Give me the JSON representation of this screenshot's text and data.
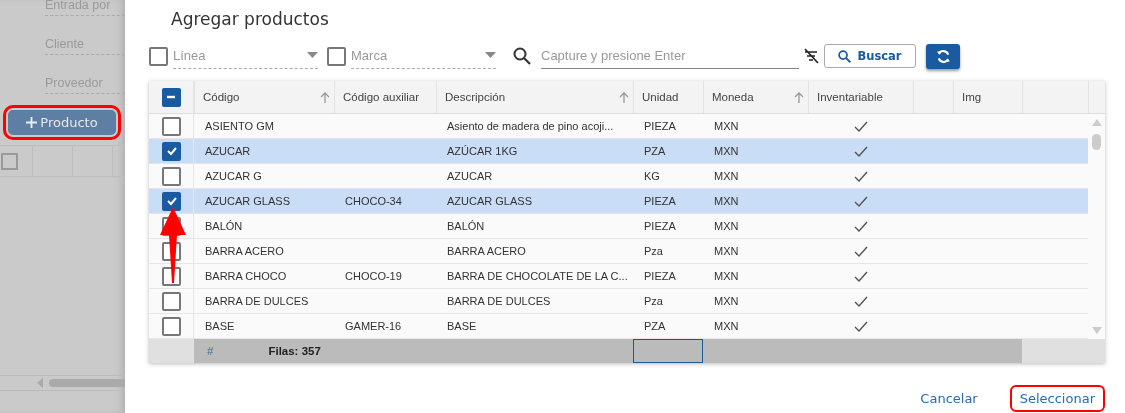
{
  "background_form": {
    "fields": [
      {
        "placeholder": "Entrada por"
      },
      {
        "placeholder": "Cliente"
      },
      {
        "placeholder": "Proveedor"
      }
    ],
    "add_button": {
      "label": "Producto",
      "highlighted": true
    },
    "grid": {
      "select_all_checked": false
    }
  },
  "dialog": {
    "title": "Agregar productos",
    "filters": [
      {
        "placeholder": "Línea",
        "checked": false
      },
      {
        "placeholder": "Marca",
        "checked": false
      }
    ],
    "search": {
      "placeholder": "Capture y presione Enter"
    },
    "search_button": {
      "label": "Buscar"
    },
    "table": {
      "select_all_partial": true,
      "columns": [
        {
          "label": "Código",
          "sortable": true
        },
        {
          "label": "Código auxiliar",
          "sortable": false
        },
        {
          "label": "Descripción",
          "sortable": true
        },
        {
          "label": "Unidad",
          "sortable": false
        },
        {
          "label": "Moneda",
          "sortable": true
        },
        {
          "label": "Inventariable",
          "sortable": false
        },
        {
          "label": "Img",
          "sortable": false
        }
      ],
      "rows": [
        {
          "selected": false,
          "codigo": "ASIENTO GM",
          "codigo_auxiliar": "",
          "descripcion": "Asiento de madera de pino acoji...",
          "unidad": "PIEZA",
          "moneda": "MXN",
          "inventariable": true
        },
        {
          "selected": true,
          "codigo": "AZUCAR",
          "codigo_auxiliar": "",
          "descripcion": "AZÚCAR 1KG",
          "unidad": "PZA",
          "moneda": "MXN",
          "inventariable": true
        },
        {
          "selected": false,
          "codigo": "AZUCAR G",
          "codigo_auxiliar": "",
          "descripcion": "AZUCAR",
          "unidad": "KG",
          "moneda": "MXN",
          "inventariable": true
        },
        {
          "selected": true,
          "codigo": "AZUCAR GLASS",
          "codigo_auxiliar": "CHOCO-34",
          "descripcion": "AZUCAR GLASS",
          "unidad": "PIEZA",
          "moneda": "MXN",
          "inventariable": true
        },
        {
          "selected": false,
          "codigo": "BALÓN",
          "codigo_auxiliar": "",
          "descripcion": "BALÓN",
          "unidad": "PIEZA",
          "moneda": "MXN",
          "inventariable": true
        },
        {
          "selected": false,
          "codigo": "BARRA ACERO",
          "codigo_auxiliar": "",
          "descripcion": "BARRA ACERO",
          "unidad": "Pza",
          "moneda": "MXN",
          "inventariable": true
        },
        {
          "selected": false,
          "codigo": "BARRA CHOCO",
          "codigo_auxiliar": "CHOCO-19",
          "descripcion": "BARRA DE CHOCOLATE DE LA C...",
          "unidad": "PIEZA",
          "moneda": "MXN",
          "inventariable": true
        },
        {
          "selected": false,
          "codigo": "BARRA DE DULCES",
          "codigo_auxiliar": "",
          "descripcion": "BARRA DE DULCES",
          "unidad": "Pza",
          "moneda": "MXN",
          "inventariable": true
        },
        {
          "selected": false,
          "codigo": "BASE",
          "codigo_auxiliar": "GAMER-16",
          "descripcion": "BASE",
          "unidad": "PZA",
          "moneda": "MXN",
          "inventariable": true
        }
      ],
      "footer": {
        "index_mark": "#",
        "row_count": "Filas: 357"
      }
    },
    "actions": [
      {
        "label": "Cancelar",
        "highlighted": false
      },
      {
        "label": "Seleccionar",
        "highlighted": true
      }
    ]
  }
}
